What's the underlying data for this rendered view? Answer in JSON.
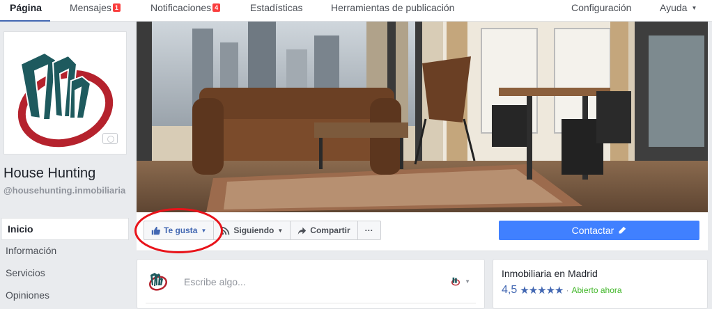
{
  "nav": {
    "items": [
      {
        "label": "Página",
        "active": true
      },
      {
        "label": "Mensajes",
        "badge": "1"
      },
      {
        "label": "Notificaciones",
        "badge": "4"
      },
      {
        "label": "Estadísticas"
      },
      {
        "label": "Herramientas de publicación"
      }
    ],
    "settings": "Configuración",
    "help": "Ayuda"
  },
  "page": {
    "name": "House Hunting",
    "handle": "@househunting.inmobiliaria"
  },
  "sidebar": {
    "items": [
      {
        "label": "Inicio",
        "active": true
      },
      {
        "label": "Información"
      },
      {
        "label": "Servicios"
      },
      {
        "label": "Opiniones"
      }
    ]
  },
  "actions": {
    "like": "Te gusta",
    "follow": "Siguiendo",
    "share": "Compartir",
    "more": "···",
    "contact": "Contactar"
  },
  "composer": {
    "placeholder": "Escribe algo..."
  },
  "about": {
    "category": "Inmobiliaria en Madrid",
    "rating": "4,5",
    "stars": "★★★★★",
    "separator": "·",
    "status": "Abierto ahora"
  },
  "colors": {
    "brand_blue": "#4267b2",
    "contact_blue": "#4080ff",
    "annotation_red": "#e8131a",
    "logo_teal": "#1e5a5e",
    "logo_red": "#b5222d"
  },
  "icons": {
    "like": "thumbs-up-icon",
    "follow": "rss-icon",
    "share": "share-arrow-icon",
    "contact": "pencil-icon",
    "camera": "camera-icon"
  }
}
